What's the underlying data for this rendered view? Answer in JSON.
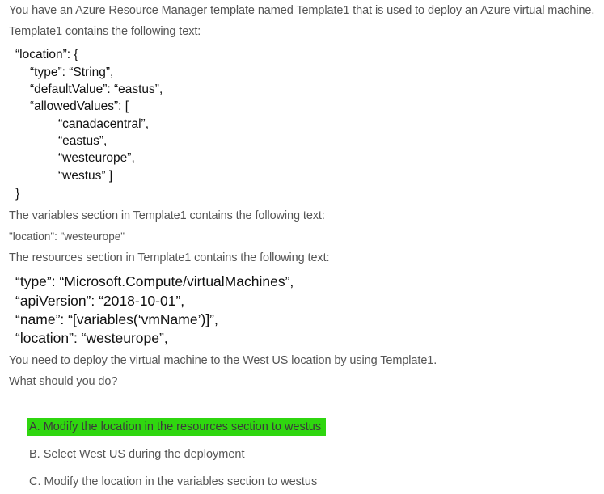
{
  "question": {
    "intro_line1": "You have an Azure Resource Manager template named Template1 that is used to deploy an Azure virtual machine.",
    "intro_line2": "Template1 contains the following text:",
    "location_block": [
      "“location”: {",
      "“type”: “String”,",
      "“defaultValue”: “eastus”,",
      "“allowedValues”: [",
      "“canadacentral”,",
      "“eastus”,",
      "“westeurope”,",
      "“westus” ]",
      "}"
    ],
    "variables_intro": "The variables section in Template1 contains the following text:",
    "variables_text": "\"location\": \"westeurope\"",
    "resources_intro": "The resources section in Template1 contains the following text:",
    "resources_block": [
      "“type”: “Microsoft.Compute/virtualMachines”,",
      "“apiVersion”: “2018-10-01”,",
      "“name”: “[variables(‘vmName’)]”,",
      "“location”: “westeurope”,"
    ],
    "task": "You need to deploy the virtual machine to the West US location by using Template1.",
    "prompt": "What should you do?"
  },
  "options": [
    {
      "label": "A. Modify the location in the resources section to westus",
      "correct": true
    },
    {
      "label": "B. Select West US during the deployment",
      "correct": false
    },
    {
      "label": "C. Modify the location in the variables section to westus",
      "correct": false
    }
  ],
  "colors": {
    "highlight": "#2fd60f",
    "prose_text": "#555555",
    "code_text": "#111111"
  }
}
